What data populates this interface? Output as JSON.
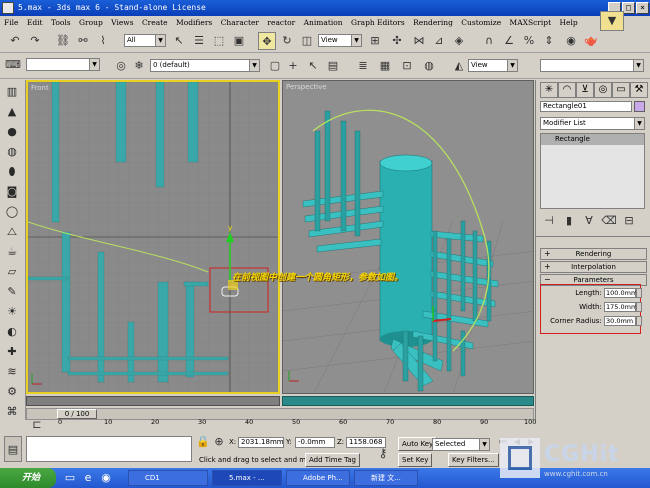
{
  "window": {
    "title": "5.max - 3ds max 6 - Stand-alone License",
    "min": "_",
    "max": "□",
    "close": "×"
  },
  "menu": [
    "File",
    "Edit",
    "Tools",
    "Group",
    "Views",
    "Create",
    "Modifiers",
    "Character",
    "reactor",
    "Animation",
    "Graph Editors",
    "Rendering",
    "Customize",
    "MAXScript",
    "Help"
  ],
  "toolbar1": {
    "selection_filter": "All",
    "ref_coord": "View"
  },
  "toolbar2": {
    "layer": "0 (default)",
    "view2": "View"
  },
  "viewports": {
    "front_label": "Front",
    "persp_label": "Perspective",
    "annotation": "在前视图中创建一个圆角矩形，参数如图。"
  },
  "command_panel": {
    "object_name": "Rectangle01",
    "modifier_list": "Modifier List",
    "stack_item": "Rectangle",
    "rollouts": [
      "Rendering",
      "Interpolation",
      "Parameters"
    ],
    "params": [
      {
        "label": "Length:",
        "value": "100.0mm"
      },
      {
        "label": "Width:",
        "value": "175.0mm"
      },
      {
        "label": "Corner Radius:",
        "value": "30.0mm"
      }
    ]
  },
  "timeline": {
    "frame": "0 / 100",
    "ticks": [
      "0",
      "10",
      "20",
      "30",
      "40",
      "50",
      "60",
      "70",
      "80",
      "90",
      "100"
    ]
  },
  "status": {
    "x_label": "X:",
    "x_value": "2031.18mm",
    "y_label": "Y:",
    "y_value": "-0.0mm",
    "z_label": "Z:",
    "z_value": "1158.068",
    "prompt": "Click and drag to select and move",
    "add_time_tag": "Add Time Tag",
    "auto_key": "Auto Key",
    "selected": "Selected",
    "set_key": "Set Key",
    "key_filters": "Key Filters..."
  },
  "taskbar": {
    "start": "开始",
    "tasks": [
      "CD1",
      "5.max - ...",
      "Adobe Ph...",
      "新建 文..."
    ]
  },
  "watermark": {
    "brand": "CGHit",
    "url": "www.cghit.com.cn"
  }
}
